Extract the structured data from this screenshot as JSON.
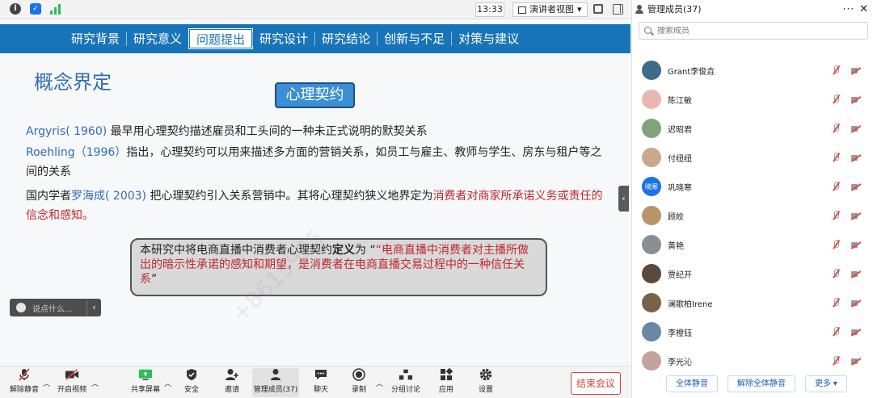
{
  "topbar": {
    "time": "13:33",
    "view_label": "演讲者视图",
    "view_caret": "▾"
  },
  "slide": {
    "nav": [
      "研究背景",
      "研究意义",
      "问题提出",
      "研究设计",
      "研究结论",
      "创新与不足",
      "对策与建议"
    ],
    "active_nav": 2,
    "title": "概念界定",
    "box_label": "心理契约",
    "p1_author": "Argyris( 1960)",
    "p1_text": " 最早用心理契约描述雇员和工头间的一种未正式说明的默契关系",
    "p2_author": "Roehling（1996）",
    "p2_text": "指出，心理契约可以用来描述多方面的营销关系，如员工与雇主、教师与学生、房东与租户等之间的关系",
    "p3_prefix": "国内学者",
    "p3_author": "罗海成( 2003)",
    "p3_mid": " 把心理契约引入关系营销中。其将心理契约狭义地界定为",
    "p3_red": "消费者对商家所承诺义务或责任的信念和感知。",
    "callout_prefix": "本研究中将电商直播中消费者心理契约",
    "callout_bold": "定义",
    "callout_mid": "为 “",
    "callout_red": "“电商直播中消费者对主播所做出的暗示性承诺的感知和期望，是消费者在电商直播交易过程中的一种信任关系",
    "callout_end": "”",
    "chat_placeholder": "说点什么...",
    "watermark": "+8615955"
  },
  "toolbar": {
    "items": [
      {
        "label": "解除静音"
      },
      {
        "label": "开启视频"
      },
      {
        "label": "共享屏幕"
      },
      {
        "label": "安全"
      },
      {
        "label": "邀请"
      },
      {
        "label": "管理成员(37)"
      },
      {
        "label": "聊天"
      },
      {
        "label": "录制"
      },
      {
        "label": "分组讨论"
      },
      {
        "label": "应用"
      },
      {
        "label": "设置"
      }
    ],
    "end_label": "结束会议"
  },
  "panel": {
    "title": "管理成员(37)",
    "more": "···",
    "close": "✕",
    "search_placeholder": "搜索成员",
    "members": [
      {
        "name": "Grant李俊垚",
        "color": "#3f6b8a"
      },
      {
        "name": "陈江敏",
        "color": "#e9b7b0"
      },
      {
        "name": "迟昭君",
        "color": "#7fa37a"
      },
      {
        "name": "付纽纽",
        "color": "#c9a88d"
      },
      {
        "name": "巩晓寒",
        "color": "#1a73e8",
        "initials": "晓寒"
      },
      {
        "name": "顾皎",
        "color": "#b9956b"
      },
      {
        "name": "黄艳",
        "color": "#8a8e96"
      },
      {
        "name": "贾纪开",
        "color": "#5b4a3c"
      },
      {
        "name": "澜歌柏Irene",
        "color": "#7a6249"
      },
      {
        "name": "李橙钰",
        "color": "#6a87a6"
      },
      {
        "name": "李光沁",
        "color": "#c4a2a0"
      }
    ],
    "buttons": [
      "全体静音",
      "解除全体静音",
      "更多 ▾"
    ]
  }
}
